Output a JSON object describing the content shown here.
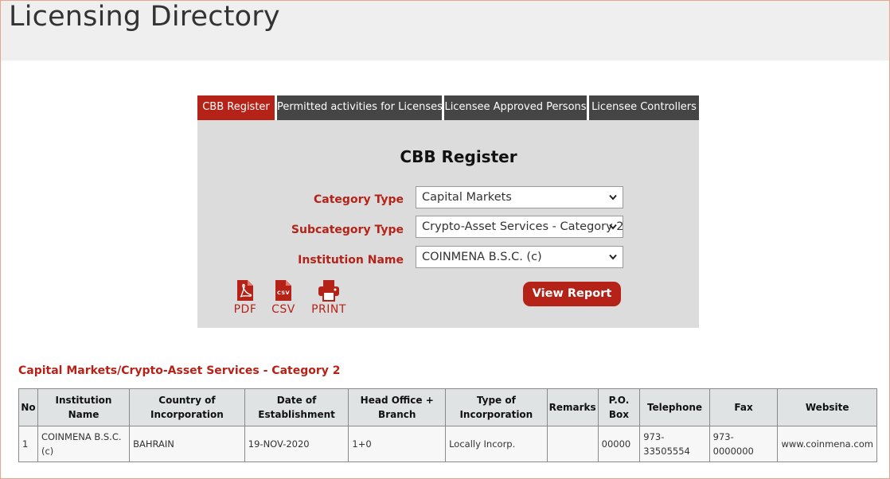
{
  "page": {
    "title": "Licensing Directory"
  },
  "tabs": [
    {
      "label": "CBB Register",
      "active": true
    },
    {
      "label": "Permitted activities for Licenses",
      "active": false
    },
    {
      "label": "Licensee Approved Persons",
      "active": false
    },
    {
      "label": "Licensee Controllers",
      "active": false
    }
  ],
  "form": {
    "title": "CBB Register",
    "category": {
      "label": "Category Type",
      "value": "Capital Markets"
    },
    "subcategory": {
      "label": "Subcategory Type",
      "value": "Crypto-Asset Services - Category 2"
    },
    "institution": {
      "label": "Institution Name",
      "value": "COINMENA B.S.C. (c)"
    },
    "exports": {
      "pdf": "PDF",
      "csv": "CSV",
      "print": "PRINT",
      "csv_icon_text": "CSV"
    },
    "view_button": "View Report"
  },
  "results": {
    "title": "Capital Markets/Crypto-Asset Services - Category 2",
    "columns": [
      "No",
      "Institution Name",
      "Country of Incorporation",
      "Date of Establishment",
      "Head Office + Branch",
      "Type of Incorporation",
      "Remarks",
      "P.O. Box",
      "Telephone",
      "Fax",
      "Website"
    ],
    "rows": [
      [
        "1",
        "COINMENA B.S.C. (c)",
        "BAHRAIN",
        "19-NOV-2020",
        "1+0",
        "Locally Incorp.",
        "",
        "00000",
        "973-33505554",
        "973-0000000",
        "www.coinmena.com"
      ]
    ]
  },
  "colors": {
    "accent": "#b52318",
    "tab_inactive": "#454545",
    "panel_bg": "#dcdcdc",
    "header_bg": "#efefef"
  }
}
